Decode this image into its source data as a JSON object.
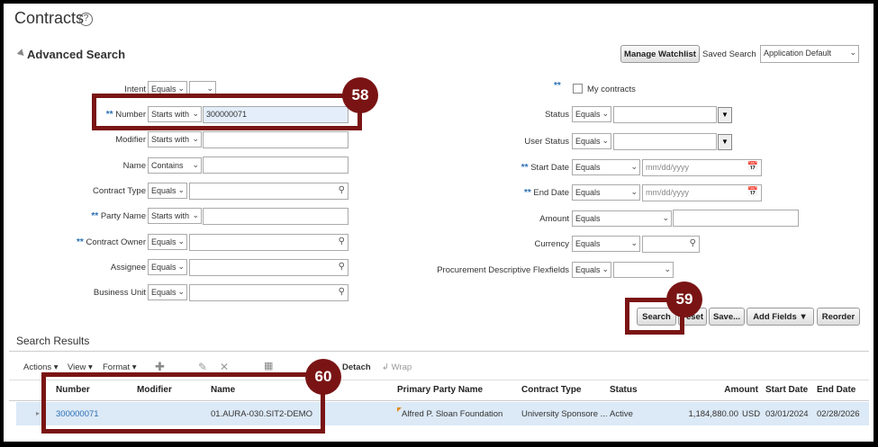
{
  "title": "Contracts",
  "help_icon": "?",
  "advanced_search": {
    "title": "Advanced Search",
    "manage_watchlist": "Manage Watchlist",
    "saved_search_label": "Saved Search",
    "saved_search_value": "Application Default",
    "required_marker": "**",
    "left_fields": [
      {
        "label": "Intent",
        "operator": "Equals",
        "value": "",
        "required": false
      },
      {
        "label": "Number",
        "operator": "Starts with",
        "value": "300000071",
        "required": true
      },
      {
        "label": "Modifier",
        "operator": "Starts with",
        "value": "",
        "required": false
      },
      {
        "label": "Name",
        "operator": "Contains",
        "value": "",
        "required": false
      },
      {
        "label": "Contract Type",
        "operator": "Equals",
        "value": "",
        "required": false
      },
      {
        "label": "Party Name",
        "operator": "Starts with",
        "value": "",
        "required": true
      },
      {
        "label": "Contract Owner",
        "operator": "Equals",
        "value": "",
        "required": true
      },
      {
        "label": "Assignee",
        "operator": "Equals",
        "value": "",
        "required": false
      },
      {
        "label": "Business Unit",
        "operator": "Equals",
        "value": "",
        "required": false
      }
    ],
    "my_contracts_label": "My contracts",
    "right_fields": [
      {
        "label": "Status",
        "operator": "Equals",
        "required": false
      },
      {
        "label": "User Status",
        "operator": "Equals",
        "required": false
      },
      {
        "label": "Start Date",
        "operator": "Equals",
        "placeholder": "mm/dd/yyyy",
        "required": true
      },
      {
        "label": "End Date",
        "operator": "Equals",
        "placeholder": "mm/dd/yyyy",
        "required": true
      },
      {
        "label": "Amount",
        "operator": "Equals",
        "required": false
      },
      {
        "label": "Currency",
        "operator": "Equals",
        "required": false
      },
      {
        "label": "Procurement Descriptive Flexfields",
        "operator": "Equals",
        "required": false
      }
    ],
    "buttons": {
      "search": "Search",
      "reset": "eset",
      "save": "Save...",
      "add_fields": "Add Fields",
      "reorder": "Reorder"
    }
  },
  "results": {
    "title": "Search Results",
    "toolbar": {
      "actions": "Actions",
      "view": "View",
      "format": "Format",
      "detach": "Detach",
      "wrap": "Wrap"
    },
    "columns": [
      "Number",
      "Modifier",
      "Name",
      "Primary Party Name",
      "Contract Type",
      "Status",
      "Amount",
      "Start Date",
      "End Date"
    ],
    "rows": [
      {
        "number": "300000071",
        "modifier": "",
        "name": "01.AURA-030.SIT2-DEMO",
        "party": "Alfred P. Sloan Foundation",
        "type": "University Sponsore ...",
        "status": "Active",
        "amount": "1,184,880.00",
        "currency": "USD",
        "start": "03/01/2024",
        "end": "02/28/2026"
      }
    ]
  },
  "callouts": [
    "58",
    "59",
    "60"
  ],
  "colors": {
    "callout": "#7a1414",
    "link": "#2a6fb5",
    "row_selected": "#dce9f6"
  }
}
